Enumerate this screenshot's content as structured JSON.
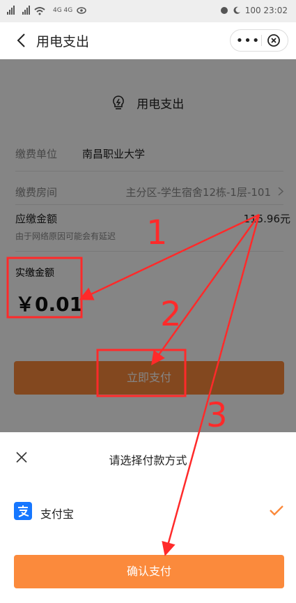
{
  "status_bar": {
    "left_text": "4G 4G",
    "right_text": "100 23:02"
  },
  "nav": {
    "title": "用电支出",
    "more_label": "•••"
  },
  "card": {
    "title": "用电支出",
    "unit_label": "缴费单位",
    "unit_value": "南昌职业大学",
    "room_label": "缴费房间",
    "room_value": "主分区-学生宿舍12栋-1层-101",
    "due_label": "应缴金额",
    "due_value": "115.96元",
    "due_note": "由于网络原因可能会有延迟",
    "paid_label": "实缴金额",
    "paid_value": "￥0.01",
    "pay_button": "立即支付"
  },
  "sheet": {
    "title": "请选择付款方式",
    "method_label": "支付宝",
    "confirm_button": "确认支付"
  },
  "annotations": {
    "num1": "1",
    "num2": "2",
    "num3": "3"
  },
  "colors": {
    "accent": "#fb8a3c",
    "annotation": "#ff2a2a",
    "alipay": "#1677ff"
  }
}
